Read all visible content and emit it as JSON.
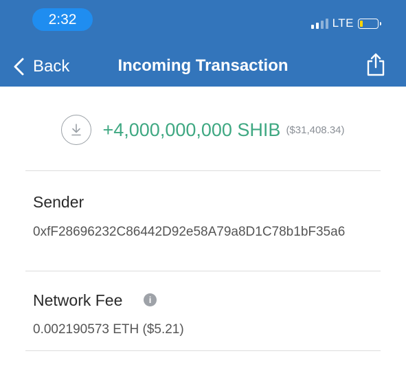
{
  "status_bar": {
    "time": "2:32",
    "network": "LTE",
    "colors": {
      "header_bg": "#3375bb",
      "time_pill": "#1f8df0",
      "battery_fill": "#ffd400"
    }
  },
  "nav": {
    "back_label": "Back",
    "title": "Incoming Transaction",
    "icons": {
      "back": "chevron-left-icon",
      "share": "share-icon"
    }
  },
  "transaction": {
    "direction_icon": "download-icon",
    "amount": "+4,000,000,000 SHIB",
    "fiat_value": "($31,408.34)",
    "amount_color": "#3fa882"
  },
  "sender": {
    "label": "Sender",
    "address": "0xfF28696232C86442D92e58A79a8D1C78b1bF35a6"
  },
  "network_fee": {
    "label": "Network Fee",
    "value": "0.002190573 ETH ($5.21)",
    "info_icon": "info-icon"
  }
}
